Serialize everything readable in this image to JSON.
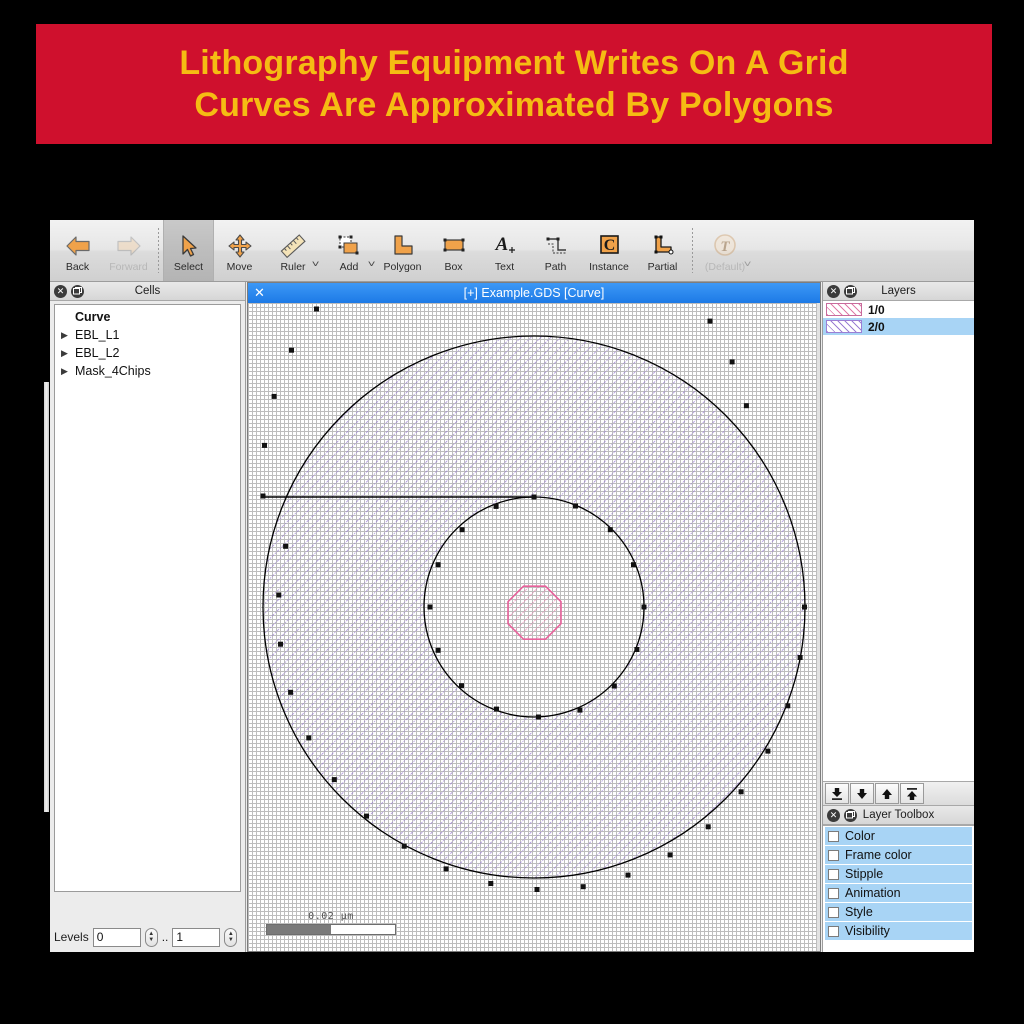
{
  "banner": {
    "line1": "Lithography Equipment Writes On A Grid",
    "line2": "Curves Are Approximated By Polygons",
    "bg_color": "#cf102d",
    "text_color": "#f5bc13"
  },
  "toolbar": {
    "items": [
      {
        "label": "Back",
        "icon": "arrow-left-icon",
        "state": "enabled",
        "dropdown": false
      },
      {
        "label": "Forward",
        "icon": "arrow-right-icon",
        "state": "disabled",
        "dropdown": false
      },
      {
        "label": "Select",
        "icon": "cursor-arrow-icon",
        "state": "selected",
        "dropdown": false
      },
      {
        "label": "Move",
        "icon": "move-cross-icon",
        "state": "enabled",
        "dropdown": false
      },
      {
        "label": "Ruler",
        "icon": "ruler-icon",
        "state": "enabled",
        "dropdown": true
      },
      {
        "label": "Add",
        "icon": "add-shape-icon",
        "state": "enabled",
        "dropdown": true
      },
      {
        "label": "Polygon",
        "icon": "polygon-icon",
        "state": "enabled",
        "dropdown": false
      },
      {
        "label": "Box",
        "icon": "box-icon",
        "state": "enabled",
        "dropdown": false
      },
      {
        "label": "Text",
        "icon": "text-a-icon",
        "state": "enabled",
        "dropdown": false
      },
      {
        "label": "Path",
        "icon": "path-icon",
        "state": "enabled",
        "dropdown": false
      },
      {
        "label": "Instance",
        "icon": "instance-c-icon",
        "state": "enabled",
        "dropdown": false
      },
      {
        "label": "Partial",
        "icon": "partial-icon",
        "state": "enabled",
        "dropdown": false
      },
      {
        "label": "(Default)",
        "icon": "technology-t-icon",
        "state": "disabled",
        "dropdown": true
      }
    ]
  },
  "cells_panel": {
    "title": "Cells",
    "close_icon": "close-icon",
    "float_icon": "undock-icon",
    "rows": [
      {
        "name": "Curve",
        "expandable": false,
        "bold": true
      },
      {
        "name": "EBL_L1",
        "expandable": true,
        "bold": false
      },
      {
        "name": "EBL_L2",
        "expandable": true,
        "bold": false
      },
      {
        "name": "Mask_4Chips",
        "expandable": true,
        "bold": false
      }
    ],
    "levels": {
      "label": "Levels",
      "from_value": "0",
      "separator": "..",
      "to_value": "1"
    }
  },
  "canvas": {
    "close_icon": "close-icon",
    "title": "[+] Example.GDS [Curve]",
    "scalebar": {
      "label": "0.02 µm",
      "fill_percent": 50
    },
    "shapes": {
      "annulus": {
        "layer": "2/0",
        "color": "#9b7fd4",
        "outline": "#000000",
        "outer_vertices": 32,
        "inner_vertices": 16,
        "vertex_markers": true
      },
      "octagon": {
        "layer": "1/0",
        "color": "#e8619b",
        "vertices": 8,
        "vertex_markers": false
      }
    }
  },
  "layers_panel": {
    "title": "Layers",
    "close_icon": "close-icon",
    "float_icon": "undock-icon",
    "rows": [
      {
        "name": "1/0",
        "color": "#e8619b",
        "selected": false
      },
      {
        "name": "2/0",
        "color": "#9b7fd4",
        "selected": true
      }
    ],
    "arrow_buttons": [
      {
        "icon": "move-to-bottom-icon"
      },
      {
        "icon": "move-down-icon"
      },
      {
        "icon": "move-up-icon"
      },
      {
        "icon": "move-to-top-icon"
      }
    ]
  },
  "layer_toolbox": {
    "title": "Layer Toolbox",
    "close_icon": "close-icon",
    "float_icon": "undock-icon",
    "rows": [
      {
        "label": "Color",
        "checked": false
      },
      {
        "label": "Frame color",
        "checked": false
      },
      {
        "label": "Stipple",
        "checked": false
      },
      {
        "label": "Animation",
        "checked": false
      },
      {
        "label": "Style",
        "checked": false
      },
      {
        "label": "Visibility",
        "checked": false
      }
    ]
  }
}
